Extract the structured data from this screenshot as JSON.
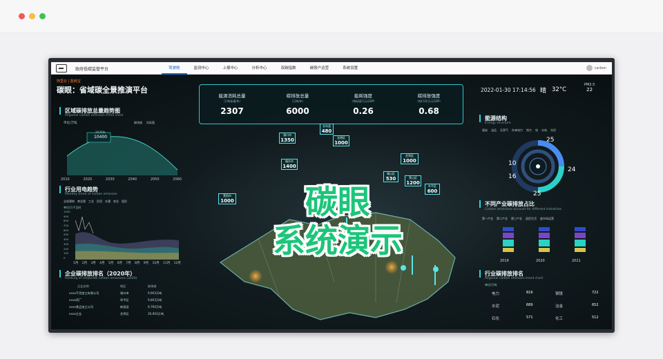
{
  "app": {
    "title": "政府低碳监管平台",
    "user": "carbon"
  },
  "nav": [
    "驾驶舱",
    "监测中心",
    "上报中心",
    "分析中心",
    "双碳指数",
    "碳账户运营",
    "系统设置"
  ],
  "header": {
    "brand": "阿里云 | 能耗宝",
    "platform": "碳眼：省域碳全景推演平台",
    "datetime": "2022-01-30 17:14:56",
    "weather": "晴",
    "temperature": "32°C",
    "pm_label": "PM2.5",
    "pm_value": "22"
  },
  "kpis": [
    {
      "label": "能源消耗总量",
      "unit": "（万吨标煤/年）",
      "value": "2307"
    },
    {
      "label": "碳排放总量",
      "unit": "（万吨/年）",
      "value": "6000"
    },
    {
      "label": "能耗强度",
      "unit": "（吨标煤/万元GDP）",
      "value": "0.26"
    },
    {
      "label": "碳排放强度",
      "unit": "（吨CO2/万元GDP）",
      "value": "0.68"
    }
  ],
  "trend": {
    "title": "区域碳排放总量趋势图",
    "subtitle": "Regional carbon emission trend chart",
    "unit": "单位/万吨",
    "legend": [
      "碳排放",
      "实际值"
    ],
    "years": [
      "2010",
      "2020",
      "2030",
      "2040",
      "2050",
      "2060"
    ],
    "tooltip_year": "2020年",
    "tooltip_value": "10400"
  },
  "power": {
    "title": "行业用电趋势",
    "subtitle": "Monthly trend of carbon emission",
    "unit": "单位/万千瓦时",
    "legend": [
      "全部建筑",
      "商业楼",
      "工业",
      "民用",
      "交通",
      "农业",
      "居民"
    ],
    "yticks": [
      "1000",
      "900",
      "800",
      "700",
      "600",
      "500",
      "400",
      "300",
      "200",
      "100",
      "0"
    ],
    "months": [
      "1月",
      "2月",
      "3月",
      "4月",
      "5月",
      "6月",
      "7月",
      "8月",
      "9月",
      "10月",
      "11月",
      "12月"
    ]
  },
  "ranking": {
    "title": "企业碳排放排名（2020年）",
    "subtitle": "Ranking of corporate carbon emissions (2020)",
    "headers": [
      "企业名称",
      "地区",
      "碳排放"
    ],
    "rows": [
      [
        "xxxx干货加工有限公司",
        "湖口市",
        "9,903万吨"
      ],
      [
        "xxxx药厂",
        "阜平区",
        "9,803万吨"
      ],
      [
        "xxxx食品加工公司",
        "新昌县",
        "9,760万吨"
      ],
      [
        "xxxx企业",
        "芝罘区",
        "20,903万吨"
      ]
    ]
  },
  "map": {
    "labels": [
      {
        "name": "湖口市",
        "value": "1350"
      },
      {
        "name": "长岛县",
        "value": "480"
      },
      {
        "name": "龙港区",
        "value": "1000"
      },
      {
        "name": "烟台市",
        "value": "1400"
      },
      {
        "name": "芝罘区",
        "value": "1000"
      },
      {
        "name": "福山区",
        "value": "530"
      },
      {
        "name": "莱山区",
        "value": "1200"
      },
      {
        "name": "牟平区",
        "value": "600"
      },
      {
        "name": "莱阳市",
        "value": "1000"
      }
    ]
  },
  "energy": {
    "title": "能源结构",
    "subtitle": "Energy structure",
    "legend": [
      "煤炭",
      "油品",
      "天然气",
      "外来电力",
      "热力",
      "电",
      "水电",
      "光伏"
    ],
    "values": [
      25,
      24,
      25,
      16,
      10
    ]
  },
  "industry": {
    "title": "不同产业碳排放占比",
    "subtitle": "Carbon emissions account for different industries",
    "legend": [
      "第一产业",
      "第二产业",
      "第三产业",
      "居民生活",
      "度市场运营"
    ],
    "years": [
      "2019",
      "2020",
      "2021"
    ]
  },
  "industry_rank": {
    "title": "行业碳排放排名",
    "subtitle": "Regional carbon emission trend chart",
    "unit": "单位/万吨",
    "items": [
      {
        "name": "电力",
        "value": "816"
      },
      {
        "name": "钢铁",
        "value": "722"
      },
      {
        "name": "水泥",
        "value": "689"
      },
      {
        "name": "冶金",
        "value": "652"
      },
      {
        "name": "石化",
        "value": "571"
      },
      {
        "name": "化工",
        "value": "512"
      }
    ]
  },
  "overlay": {
    "line1": "碳眼",
    "line2": "系统演示"
  }
}
